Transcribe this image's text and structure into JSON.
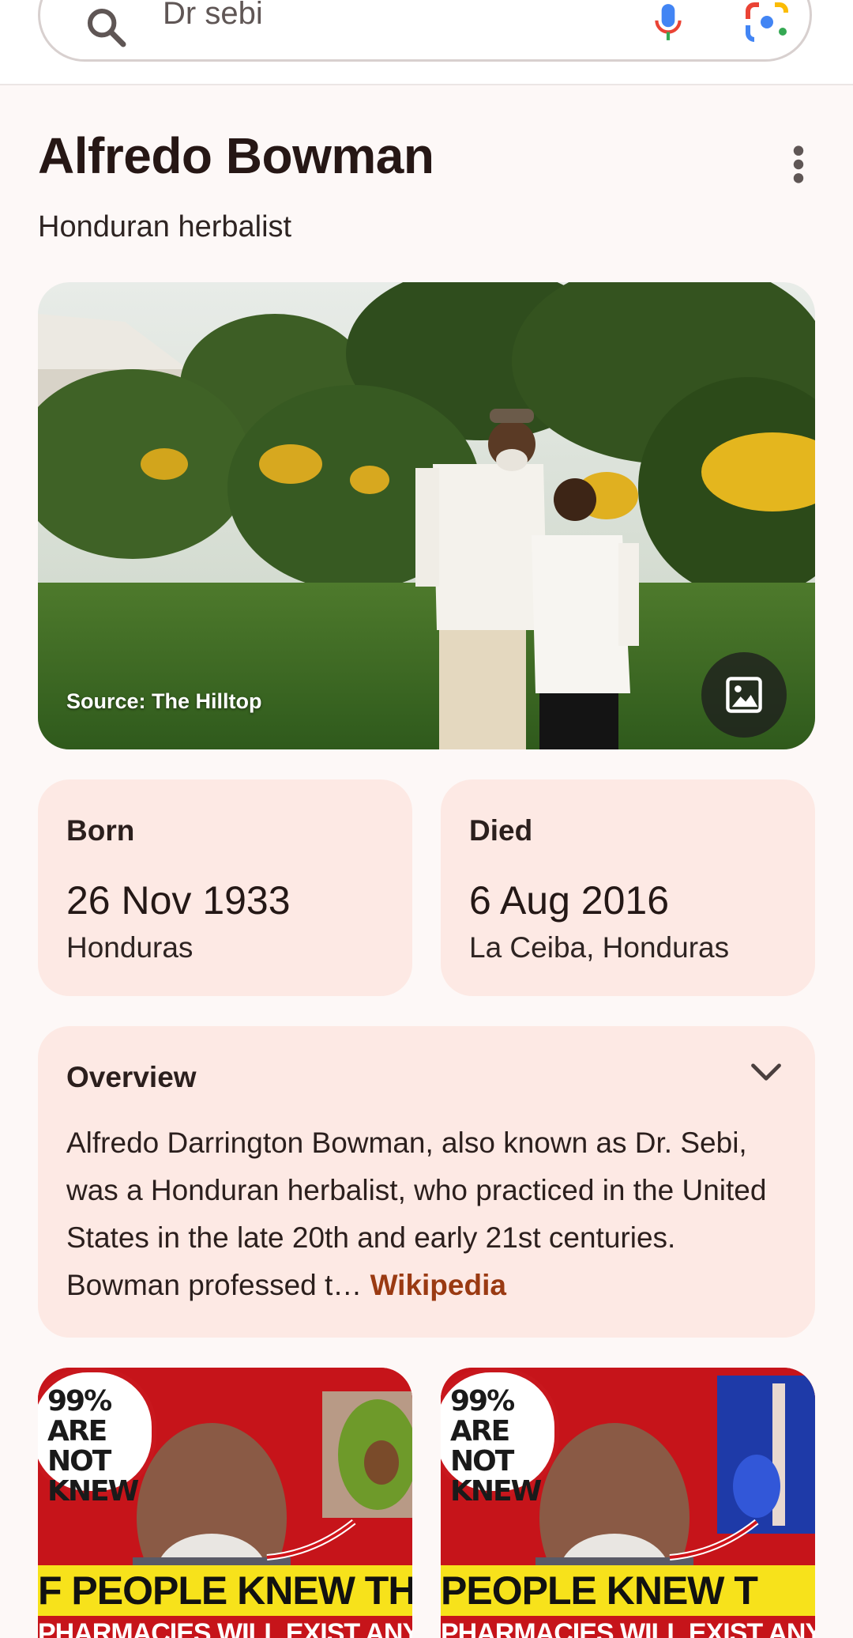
{
  "search": {
    "query": "Dr sebi",
    "icons": [
      "search-icon",
      "mic-icon",
      "google-lens-icon"
    ]
  },
  "entity": {
    "title": "Alfredo Bowman",
    "subtitle": "Honduran herbalist"
  },
  "hero": {
    "source": "Source: The Hilltop"
  },
  "facts": {
    "born": {
      "label": "Born",
      "date": "26 Nov 1933",
      "place": "Honduras"
    },
    "died": {
      "label": "Died",
      "date": "6 Aug 2016",
      "place": "La Ceiba, Honduras"
    }
  },
  "overview": {
    "title": "Overview",
    "text": "Alfredo Darrington Bowman, also known as Dr. Sebi, was a Honduran herbalist, who practiced in the United States in the late 20th and early 21st centuries. Bowman professed t… ",
    "link": "Wikipedia"
  },
  "thumbnails": [
    {
      "badge": "99%\nARE NOT\nKNEW",
      "headline": "F PEOPLE KNEW TH",
      "sub": "PHARMACIES WILL EXIST ANY"
    },
    {
      "badge": "99%\nARE NOT\nKNEW",
      "headline": " PEOPLE KNEW T",
      "sub": "PHARMACIES WILL EXIST ANY"
    }
  ],
  "colors": {
    "card_bg": "#fde9e4",
    "link": "#9a3a12",
    "page_bg": "#fdf8f7"
  }
}
